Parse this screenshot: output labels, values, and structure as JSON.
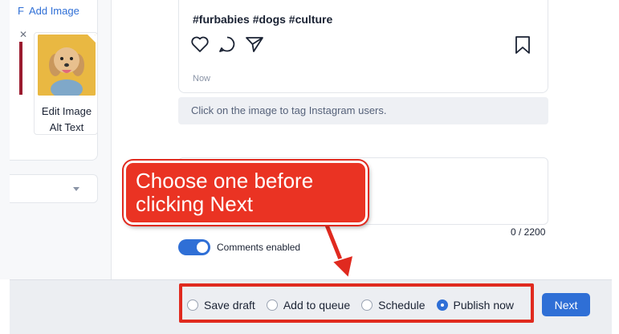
{
  "left_panel": {
    "add_image_lead": "F",
    "add_image_label": "Add Image",
    "close_glyph": "✕",
    "edit_image_line1": "Edit Image",
    "edit_image_line2": "Alt Text"
  },
  "post_preview": {
    "hashtags": "#furbabies #dogs #culture",
    "timestamp": "Now",
    "tag_hint": "Click on the image to tag Instagram users."
  },
  "caption": {
    "char_count": "0 / 2200"
  },
  "comments": {
    "label": "Comments enabled",
    "enabled": true
  },
  "publish_options": [
    {
      "label": "Save draft",
      "selected": false
    },
    {
      "label": "Add to queue",
      "selected": false
    },
    {
      "label": "Schedule",
      "selected": false
    },
    {
      "label": "Publish now",
      "selected": true
    }
  ],
  "next_button": "Next",
  "annotation": {
    "line1": "Choose one before",
    "line2": "clicking Next"
  },
  "colors": {
    "accent": "#2f6fd6",
    "annotation_red": "#ea3323",
    "thumbnail_bg": "#e9b842"
  },
  "icons": [
    "heart-icon",
    "comment-icon",
    "share-icon",
    "bookmark-icon",
    "chevron-down-icon"
  ]
}
